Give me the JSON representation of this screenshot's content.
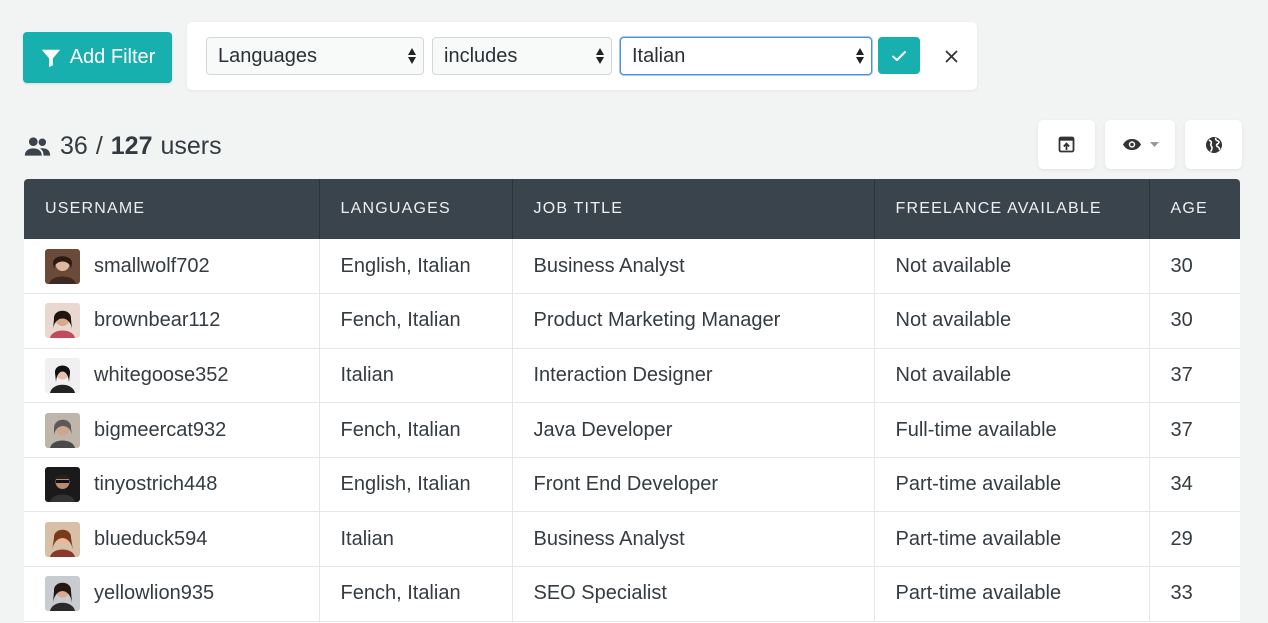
{
  "toolbar": {
    "add_filter_label": "Add Filter"
  },
  "filter": {
    "field": "Languages",
    "operator": "includes",
    "value": "Italian"
  },
  "summary": {
    "shown": "36",
    "separator": "/",
    "total": "127",
    "unit": "users"
  },
  "colors": {
    "accent": "#17b0af",
    "header_bg": "#3a444d",
    "focus": "#4a8fe0"
  },
  "table": {
    "columns": [
      "USERNAME",
      "LANGUAGES",
      "JOB TITLE",
      "FREELANCE AVAILABLE",
      "AGE"
    ],
    "rows": [
      {
        "username": "smallwolf702",
        "languages": "English, Italian",
        "job_title": "Business Analyst",
        "freelance": "Not available",
        "age": "30"
      },
      {
        "username": "brownbear112",
        "languages": "Fench, Italian",
        "job_title": "Product Marketing Manager",
        "freelance": "Not available",
        "age": "30"
      },
      {
        "username": "whitegoose352",
        "languages": "Italian",
        "job_title": "Interaction Designer",
        "freelance": "Not available",
        "age": "37"
      },
      {
        "username": "bigmeercat932",
        "languages": "Fench, Italian",
        "job_title": "Java Developer",
        "freelance": "Full-time available",
        "age": "37"
      },
      {
        "username": "tinyostrich448",
        "languages": "English, Italian",
        "job_title": "Front End Developer",
        "freelance": "Part-time available",
        "age": "34"
      },
      {
        "username": "blueduck594",
        "languages": "Italian",
        "job_title": "Business Analyst",
        "freelance": "Part-time available",
        "age": "29"
      },
      {
        "username": "yellowlion935",
        "languages": "Fench, Italian",
        "job_title": "SEO Specialist",
        "freelance": "Part-time available",
        "age": "33"
      }
    ]
  }
}
